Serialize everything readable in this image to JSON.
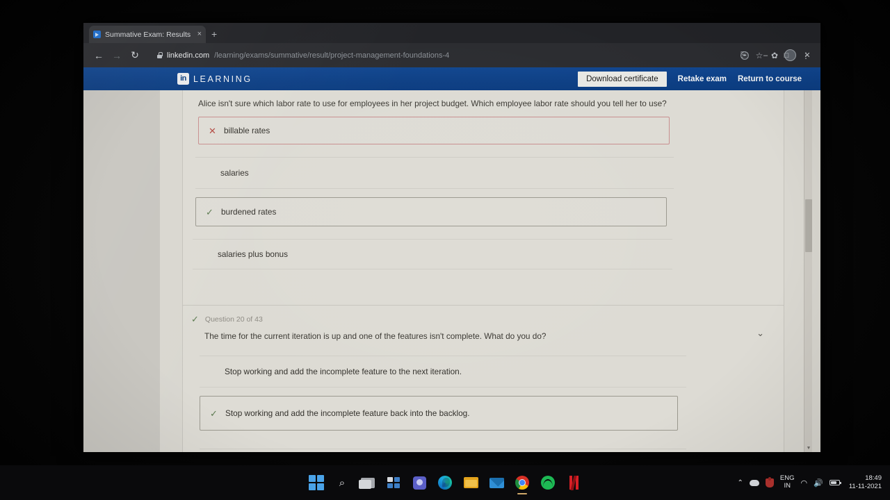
{
  "browser": {
    "tab": {
      "title": "Summative Exam: Results",
      "favicon": "video-icon",
      "close_label": "×",
      "new_tab_label": "+"
    },
    "nav": {
      "back": "←",
      "forward": "→",
      "reload": "↻"
    },
    "address": {
      "lock": "lock-icon",
      "domain": "linkedin.com",
      "path": "/learning/exams/summative/result/project-management-foundations-4"
    },
    "toolbar_icons": {
      "share": "⎘",
      "bookmark": "☆",
      "extensions": "✿",
      "profile": "profile-avatar",
      "menu": "⋮"
    },
    "window_controls": {
      "badge": "record-circle",
      "minimize": "–",
      "maximize": "□",
      "close": "✕"
    }
  },
  "site_header": {
    "logo_mark": "in",
    "wordmark": "LEARNING",
    "download_certificate": "Download certificate",
    "retake_exam": "Retake exam",
    "return_to_course": "Return to course"
  },
  "exam": {
    "questions": [
      {
        "meta": "",
        "text": "Alice isn't sure which labor rate to use for employees in her project budget. Which employee labor rate should you tell her to use?",
        "chevron": "⌄",
        "answers": [
          {
            "text": "billable rates",
            "state": "wrong",
            "mark": "✕"
          },
          {
            "text": "salaries",
            "state": "plain",
            "mark": ""
          },
          {
            "text": "burdened rates",
            "state": "correct",
            "mark": "✓"
          },
          {
            "text": "salaries plus bonus",
            "state": "plain",
            "mark": ""
          }
        ]
      },
      {
        "meta": "Question 20 of 43",
        "meta_mark": "✓",
        "text": "The time for the current iteration is up and one of the features isn't complete. What do you do?",
        "chevron": "⌄",
        "answers": [
          {
            "text": "Stop working and add the incomplete feature to the next iteration.",
            "state": "plain",
            "mark": ""
          },
          {
            "text": "Stop working and add the incomplete feature back into the backlog.",
            "state": "correct",
            "mark": "✓"
          },
          {
            "text": "",
            "state": "plain",
            "mark": ""
          }
        ]
      }
    ]
  },
  "scrollbar": {
    "up_arrow": "▲",
    "down_arrow": "▼"
  },
  "taskbar": {
    "items": [
      {
        "name": "start",
        "label": "Start"
      },
      {
        "name": "search",
        "label": "Search",
        "glyph": "⌕"
      },
      {
        "name": "task-view",
        "label": "Task View"
      },
      {
        "name": "widgets",
        "label": "Widgets"
      },
      {
        "name": "teams-chat",
        "label": "Chat"
      },
      {
        "name": "edge",
        "label": "Microsoft Edge"
      },
      {
        "name": "file-explorer",
        "label": "File Explorer"
      },
      {
        "name": "mail",
        "label": "Mail"
      },
      {
        "name": "chrome",
        "label": "Google Chrome",
        "active": true
      },
      {
        "name": "spotify",
        "label": "Spotify"
      },
      {
        "name": "netflix",
        "label": "Netflix"
      }
    ],
    "tray": {
      "overflow": "⌃",
      "cloud": "onedrive-icon",
      "red": "app-icon",
      "language_line1": "ENG",
      "language_line2": "IN",
      "wifi": "◠",
      "volume": "🔊",
      "battery": "battery-icon",
      "time": "18:49",
      "date": "11-11-2021"
    }
  }
}
